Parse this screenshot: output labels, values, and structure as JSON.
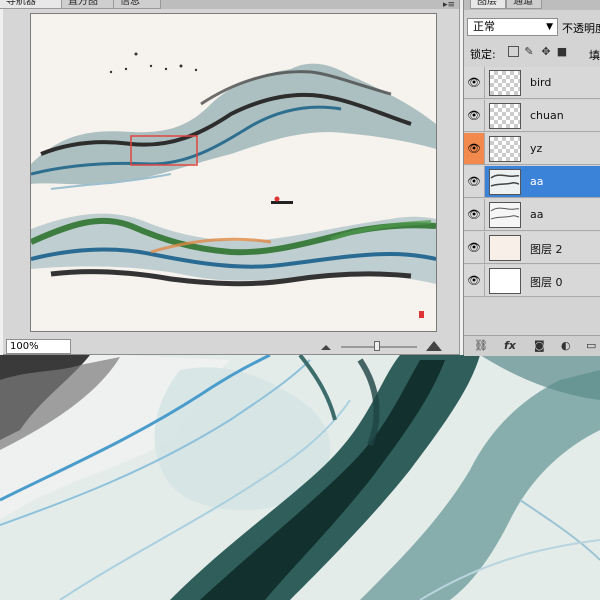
{
  "navigator": {
    "tabs": [
      "导航器",
      "直方图",
      "信息"
    ],
    "zoom_value": "100%"
  },
  "layers_panel": {
    "tabs": [
      "图层",
      "通道"
    ],
    "blend_mode": "正常",
    "opacity_label": "不透明度",
    "lock_label": "锁定:",
    "fill_label": "填充",
    "layers": [
      {
        "name": "bird",
        "selected": false,
        "thumb": "transparent"
      },
      {
        "name": "chuan",
        "selected": false,
        "thumb": "transparent"
      },
      {
        "name": "yz",
        "selected": false,
        "thumb": "transparent"
      },
      {
        "name": "aa",
        "selected": true,
        "thumb": "landscape"
      },
      {
        "name": "aa",
        "selected": false,
        "thumb": "landscape"
      },
      {
        "name": "图层 2",
        "selected": false,
        "thumb": "cream"
      },
      {
        "name": "图层 0",
        "selected": false,
        "thumb": "white"
      }
    ]
  },
  "colors": {
    "selected_layer": "#3a83d8",
    "eye_highlight": "#f28a4e",
    "nav_view_box": "#e0453f"
  },
  "icons": [
    "eye-icon",
    "lock-transparent-icon",
    "lock-brush-icon",
    "lock-move-icon",
    "lock-all-icon",
    "link-icon",
    "fx-icon",
    "mask-icon",
    "adjustment-icon",
    "folder-icon",
    "zoom-out-icon",
    "zoom-in-icon"
  ]
}
